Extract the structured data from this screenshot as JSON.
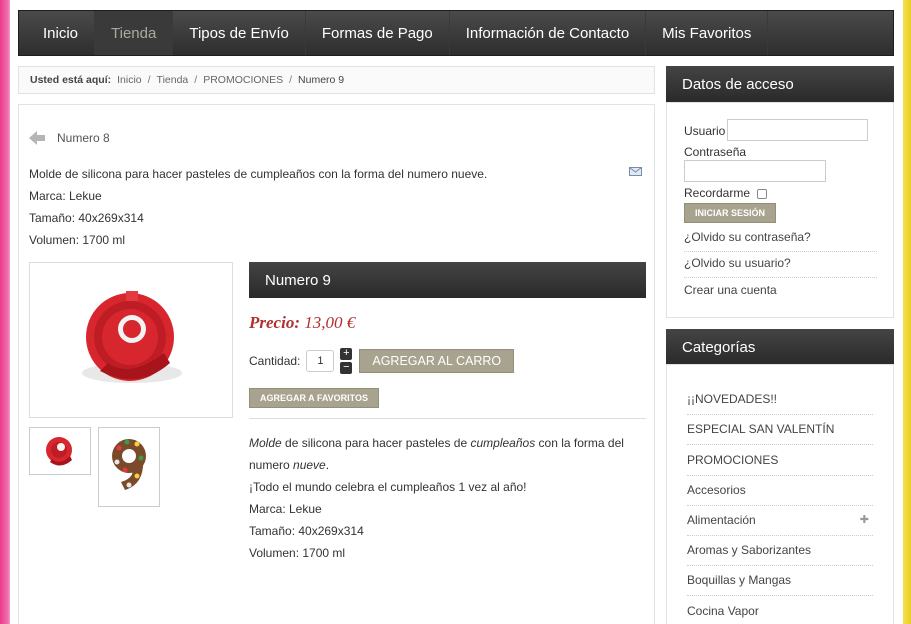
{
  "nav": {
    "items": [
      {
        "label": "Inicio",
        "active": false
      },
      {
        "label": "Tienda",
        "active": true
      },
      {
        "label": "Tipos de Envío",
        "active": false
      },
      {
        "label": "Formas de Pago",
        "active": false
      },
      {
        "label": "Información de Contacto",
        "active": false
      },
      {
        "label": "Mis Favoritos",
        "active": false
      }
    ]
  },
  "breadcrumb": {
    "label": "Usted está aquí:",
    "items": [
      "Inicio",
      "Tienda",
      "PROMOCIONES"
    ],
    "current": "Numero 9"
  },
  "product": {
    "prev_link": "Numero 8",
    "short_desc": [
      "Molde de silicona para hacer pasteles de cumpleaños con la forma del numero nueve.",
      "Marca: Lekue",
      "Tamaño: 40x269x314",
      "Volumen: 1700 ml"
    ],
    "title": "Numero 9",
    "price_label": "Precio:",
    "price_value": "13,00 €",
    "qty_label": "Cantidad:",
    "qty_value": "1",
    "add_to_cart": "AGREGAR AL CARRO",
    "add_to_favorites": "AGREGAR A FAVORITOS",
    "long_desc": {
      "l1_a": "Molde",
      "l1_b": " de silicona para hacer pasteles de ",
      "l1_c": "cumpleaños",
      "l1_d": " con la forma del",
      "l2_a": "numero ",
      "l2_b": "nueve",
      "l2_c": ".",
      "l3": "¡Todo el mundo celebra el cumpleaños 1 vez al año!",
      "l4": "Marca: Lekue",
      "l5": "Tamaño: 40x269x314",
      "l6": "Volumen: 1700 ml"
    }
  },
  "login": {
    "heading": "Datos de acceso",
    "user_label": "Usuario",
    "pass_label": "Contraseña",
    "remember_label": "Recordarme",
    "submit": "INICIAR SESIÓN",
    "forgot_password": "¿Olvido su contraseña?",
    "forgot_user": "¿Olvido su usuario?",
    "create_account": "Crear una cuenta"
  },
  "categories": {
    "heading": "Categorías",
    "items": [
      "¡¡NOVEDADES!!",
      "ESPECIAL SAN VALENTÍN",
      "PROMOCIONES",
      "Accesorios",
      "Alimentación",
      "Aromas y Saborizantes",
      "Boquillas y Mangas",
      "Cocina Vapor"
    ]
  },
  "colors": {
    "accent_button": "#a7a38e",
    "price": "#b0312f",
    "header_bar": "#2e2e2e"
  }
}
